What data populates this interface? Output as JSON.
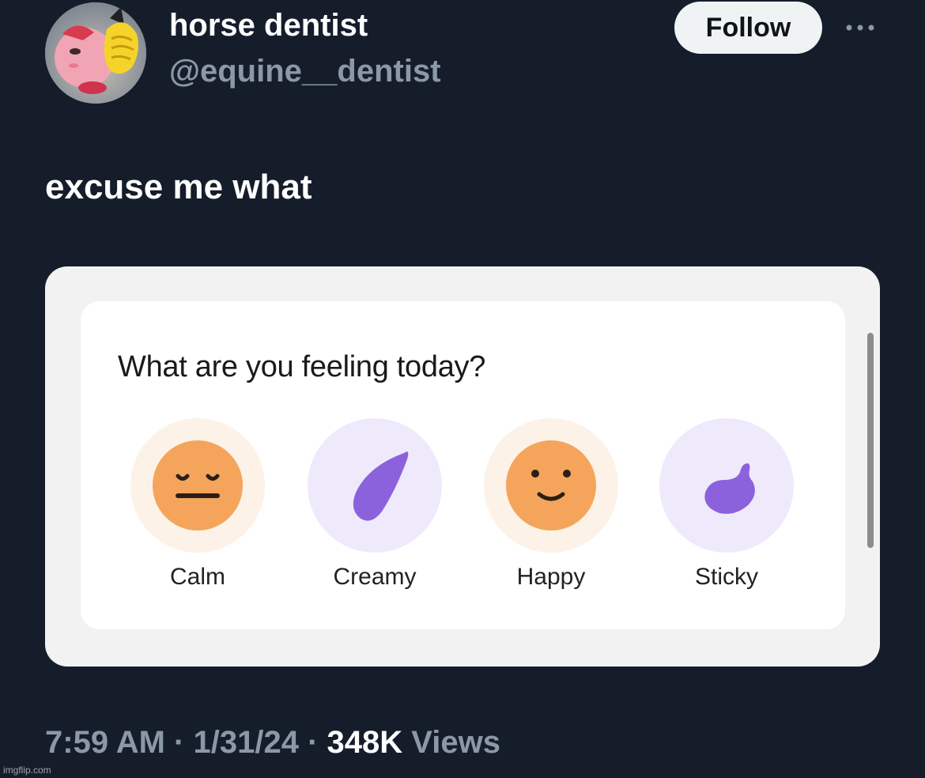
{
  "author": {
    "display_name": "horse dentist",
    "handle": "@equine__dentist",
    "avatar_icon": "avatar-cartoon-characters-icon"
  },
  "header": {
    "follow_label": "Follow",
    "more_icon": "more-options-icon"
  },
  "tweet": {
    "text": "excuse me what"
  },
  "media": {
    "question": "What are you feeling today?",
    "options": [
      {
        "label": "Calm",
        "icon": "calm-face-icon"
      },
      {
        "label": "Creamy",
        "icon": "purple-drop-icon"
      },
      {
        "label": "Happy",
        "icon": "happy-face-icon"
      },
      {
        "label": "Sticky",
        "icon": "purple-drop-curled-icon"
      }
    ]
  },
  "meta": {
    "time": "7:59 AM",
    "separator": "·",
    "date": "1/31/24",
    "views_count": "348K",
    "views_label": "Views"
  },
  "watermark": "imgflip.com",
  "colors": {
    "background": "#151d2b",
    "face": "#f4a55b",
    "drop": "#8c62dc",
    "muted_text": "#8b98a5"
  }
}
